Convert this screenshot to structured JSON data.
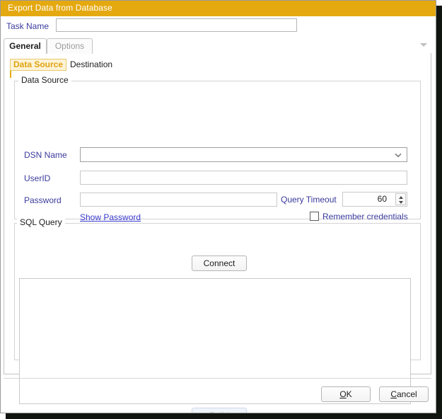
{
  "window": {
    "title": "Export Data from Database",
    "accent_color": "#e5a910",
    "label_color": "#3a3a9e",
    "link_color": "#3a3ad0"
  },
  "task": {
    "label": "Task Name",
    "value": "",
    "placeholder": ""
  },
  "tabs": {
    "items": [
      {
        "label": "General",
        "selected": true
      },
      {
        "label": "Options",
        "selected": false
      }
    ],
    "overflow_icon": "chevron-down-icon"
  },
  "subtabs": {
    "items": [
      {
        "label": "Data Source",
        "selected": true
      },
      {
        "label": "Destination",
        "selected": false
      }
    ]
  },
  "data_source": {
    "group_title": "Data Source",
    "dsn": {
      "label": "DSN Name",
      "value": "",
      "icon": "chevron-down-icon"
    },
    "userid": {
      "label": "UserID",
      "value": "",
      "placeholder": ""
    },
    "password": {
      "label": "Password",
      "value": "",
      "placeholder": ""
    },
    "show_password_link": "Show Password",
    "query_timeout": {
      "label": "Query Timeout",
      "value": "60"
    },
    "remember_credentials": {
      "label": "Remember credentials",
      "checked": false
    }
  },
  "connect_button": "Connect",
  "sql_query": {
    "group_title": "SQL Query",
    "value": "",
    "placeholder": ""
  },
  "build_button": "Build",
  "footer": {
    "ok": {
      "mnemonic": "O",
      "rest": "K"
    },
    "cancel": {
      "mnemonic": "C",
      "rest": "ancel"
    }
  }
}
